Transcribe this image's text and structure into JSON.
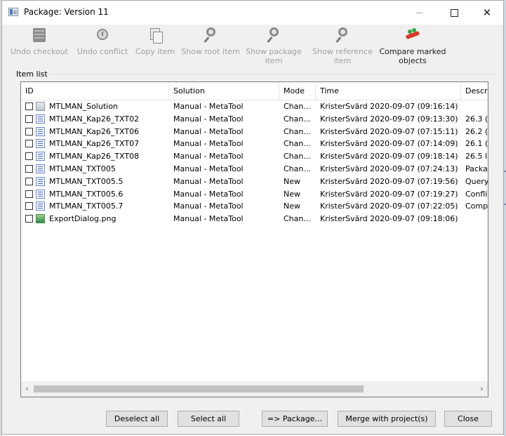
{
  "window": {
    "title": "Package: Version 11",
    "controls": {
      "minimize": "—",
      "maximize": "☐",
      "close": "✕"
    }
  },
  "toolbar": [
    {
      "label_line1": "Undo checkout",
      "label_line2": "",
      "icon": "database-icon",
      "enabled": false
    },
    {
      "label_line1": "Undo conflict",
      "label_line2": "",
      "icon": "clock-icon",
      "enabled": false
    },
    {
      "label_line1": "Copy item",
      "label_line2": "",
      "icon": "copy-icon",
      "enabled": false
    },
    {
      "label_line1": "Show root item",
      "label_line2": "",
      "icon": "magnifier-icon",
      "enabled": false
    },
    {
      "label_line1": "Show package",
      "label_line2": "item",
      "icon": "magnifier-icon",
      "enabled": false
    },
    {
      "label_line1": "Show reference",
      "label_line2": "item",
      "icon": "magnifier-icon",
      "enabled": false
    },
    {
      "label_line1": "Compare marked",
      "label_line2": "objects",
      "icon": "compare-icon",
      "enabled": true
    }
  ],
  "item_list": {
    "label": "Item list",
    "columns": [
      "ID",
      "Solution",
      "Mode",
      "Time",
      "Descri"
    ],
    "rows": [
      {
        "id": "MTLMAN_Solution",
        "solution": "Manual - MetaTool",
        "mode": "Chan...",
        "time": "KristerSvärd 2020-09-07 (09:16:14)",
        "description": "",
        "icon": "solution",
        "checked": false
      },
      {
        "id": "MTLMAN_Kap26_TXT02",
        "solution": "Manual - MetaTool",
        "mode": "Chan...",
        "time": "KristerSvärd 2020-09-07 (09:13:30)",
        "description": "26.3 (",
        "icon": "doc",
        "checked": false
      },
      {
        "id": "MTLMAN_Kap26_TXT06",
        "solution": "Manual - MetaTool",
        "mode": "Chan...",
        "time": "KristerSvärd 2020-09-07 (07:15:11)",
        "description": "26.2 (",
        "icon": "doc",
        "checked": false
      },
      {
        "id": "MTLMAN_Kap26_TXT07",
        "solution": "Manual - MetaTool",
        "mode": "Chan...",
        "time": "KristerSvärd 2020-09-07 (07:14:09)",
        "description": "26.1 (",
        "icon": "doc",
        "checked": false
      },
      {
        "id": "MTLMAN_Kap26_TXT08",
        "solution": "Manual - MetaTool",
        "mode": "Chan...",
        "time": "KristerSvärd 2020-09-07 (09:18:14)",
        "description": "26.5 I",
        "icon": "doc",
        "checked": false
      },
      {
        "id": "MTLMAN_TXT005",
        "solution": "Manual - MetaTool",
        "mode": "Chan...",
        "time": "KristerSvärd 2020-09-07 (07:24:13)",
        "description": "Packa",
        "icon": "doc",
        "checked": false
      },
      {
        "id": "MTLMAN_TXT005.5",
        "solution": "Manual - MetaTool",
        "mode": "New",
        "time": "KristerSvärd 2020-09-07 (07:19:56)",
        "description": "Query",
        "icon": "doc",
        "checked": false
      },
      {
        "id": "MTLMAN_TXT005.6",
        "solution": "Manual - MetaTool",
        "mode": "New",
        "time": "KristerSvärd 2020-09-07 (07:19:27)",
        "description": "Confli",
        "icon": "doc",
        "checked": false
      },
      {
        "id": "MTLMAN_TXT005.7",
        "solution": "Manual - MetaTool",
        "mode": "New",
        "time": "KristerSvärd 2020-09-07 (07:22:05)",
        "description": "Compa",
        "icon": "doc",
        "checked": false
      },
      {
        "id": "ExportDialog.png",
        "solution": "Manual - MetaTool",
        "mode": "Chan...",
        "time": "KristerSvärd 2020-09-07 (09:18:06)",
        "description": "",
        "icon": "image",
        "checked": false
      }
    ],
    "scroll_left": "‹",
    "scroll_right": "›"
  },
  "buttons": {
    "deselect_all": "Deselect all",
    "select_all": "Select all",
    "package": "=> Package...",
    "merge": "Merge with project(s)",
    "close": "Close"
  }
}
